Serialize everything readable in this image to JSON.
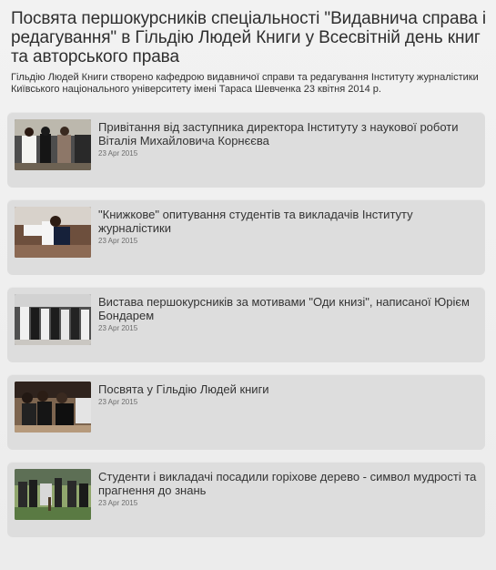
{
  "header": {
    "title": "Посвята першокурсників спеціальності \"Видавнича справа і редагування\" в Гільдію Людей Книги у Всесвітній день книг та авторського права",
    "subtitle": "Гільдію Людей Книги створено кафедрою видавничої справи та редагування Інституту журналістики Київського національного університету імені Тараса Шевченка 23 квітня 2014 р."
  },
  "feed": {
    "items": [
      {
        "headline": "Привітання від заступника директора Інституту з наукової роботи Віталія Михайловича Корнєєва",
        "date": "23 Apr 2015",
        "thumb_icon": "photo-thumbnail-icon"
      },
      {
        "headline": "\"Книжкове\" опитування студентів та викладачів Інституту журналістики",
        "date": "23 Apr 2015",
        "thumb_icon": "photo-thumbnail-icon"
      },
      {
        "headline": "Вистава першокурсників за мотивами \"Оди книзі\", написаної Юрієм Бондарем",
        "date": "23 Apr 2015",
        "thumb_icon": "photo-thumbnail-icon"
      },
      {
        "headline": "Посвята у Гільдію Людей книги",
        "date": "23 Apr 2015",
        "thumb_icon": "photo-thumbnail-icon"
      },
      {
        "headline": "Студенти і викладачі посадили горіхове дерево - символ мудрості та прагнення до знань",
        "date": "23 Apr 2015",
        "thumb_icon": "photo-thumbnail-icon"
      }
    ]
  },
  "colors": {
    "page_background": "#efefef",
    "card_background": "#dddddd",
    "title_text": "#2e2e2e",
    "date_text": "#6c6c6c"
  }
}
